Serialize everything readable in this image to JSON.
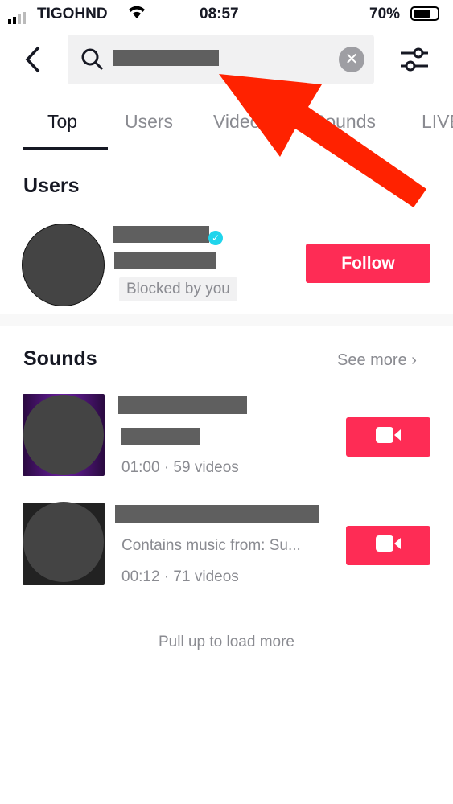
{
  "status": {
    "carrier": "TIGOHND",
    "time": "08:57",
    "battery": "70%"
  },
  "search": {
    "query_redacted": true
  },
  "tabs": [
    {
      "label": "Top",
      "active": true
    },
    {
      "label": "Users"
    },
    {
      "label": "Videos"
    },
    {
      "label": "Sounds"
    },
    {
      "label": "LIVE"
    }
  ],
  "users": {
    "title": "Users",
    "items": [
      {
        "badge": "Blocked by you",
        "verified": true,
        "follow_label": "Follow"
      }
    ]
  },
  "sounds": {
    "title": "Sounds",
    "see_more": "See more",
    "items": [
      {
        "meta": "01:00 · 59 videos"
      },
      {
        "subtitle": "Contains music from: Su...",
        "meta": "00:12 · 71 videos"
      }
    ]
  },
  "footer": {
    "load_more": "Pull up to load more"
  },
  "colors": {
    "accent": "#fe2c55",
    "verified": "#20d5ec",
    "annotation_arrow": "#ff2200"
  }
}
